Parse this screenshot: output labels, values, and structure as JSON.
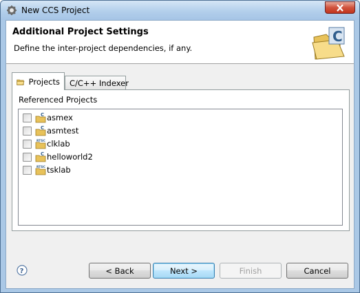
{
  "window": {
    "title": "New CCS Project"
  },
  "header": {
    "title": "Additional Project Settings",
    "description": "Define the inter-project dependencies, if any."
  },
  "tabs": [
    {
      "label": "Projects",
      "icon": "folder-icon",
      "active": true
    },
    {
      "label": "C/C++ Indexer",
      "active": false
    }
  ],
  "projects_panel": {
    "label": "Referenced Projects",
    "items": [
      {
        "name": "asmex",
        "icon": "c-project-icon",
        "checked": false
      },
      {
        "name": "asmtest",
        "icon": "c-project-icon",
        "checked": false
      },
      {
        "name": "clklab",
        "icon": "rtsc-project-icon",
        "checked": false
      },
      {
        "name": "helloworld2",
        "icon": "c-project-icon",
        "checked": false
      },
      {
        "name": "tsklab",
        "icon": "rtsc-project-icon",
        "checked": false
      }
    ]
  },
  "buttons": {
    "back": "< Back",
    "next": "Next >",
    "finish": "Finish",
    "cancel": "Cancel"
  },
  "icons": {
    "window": "eclipse-gear-icon",
    "banner": "new-project-folder-icon",
    "help": "help-icon",
    "close": "close-icon",
    "project_overlay_c": "C",
    "project_overlay_rtsc": "RTSC"
  }
}
